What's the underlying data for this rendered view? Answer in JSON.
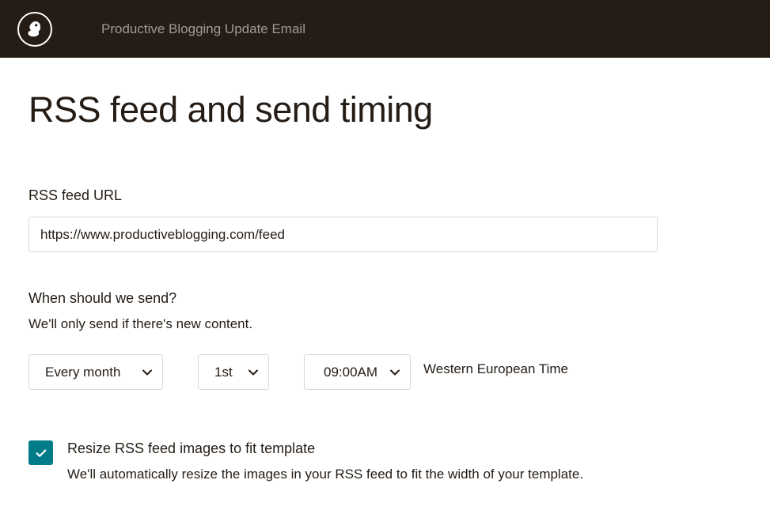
{
  "header": {
    "campaign_name": "Productive Blogging Update Email"
  },
  "page_title": "RSS feed and send timing",
  "rss_url": {
    "label": "RSS feed URL",
    "value": "https://www.productiveblogging.com/feed"
  },
  "send_schedule": {
    "heading": "When should we send?",
    "helper": "We'll only send if there's new content.",
    "frequency": "Every month",
    "day": "1st",
    "time": "09:00AM",
    "timezone": "Western European Time"
  },
  "resize_option": {
    "checked": true,
    "label": "Resize RSS feed images to fit template",
    "description": "We'll automatically resize the images in your RSS feed to fit the width of your template."
  }
}
